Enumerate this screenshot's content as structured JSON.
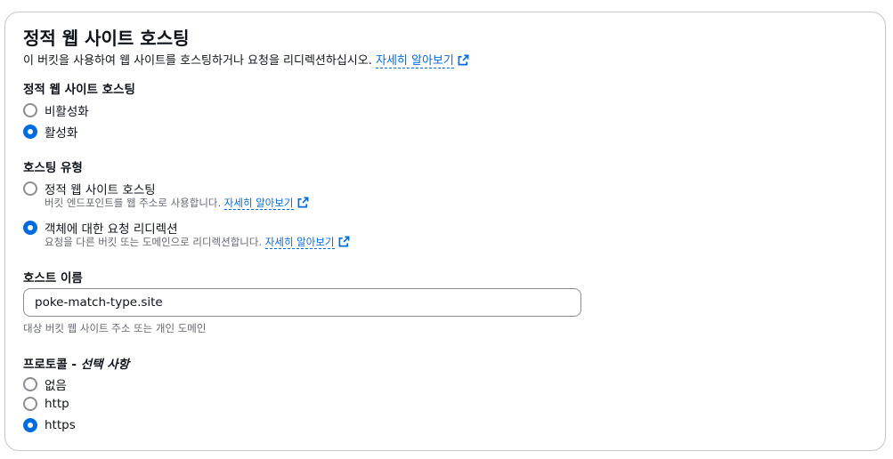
{
  "section": {
    "title": "정적 웹 사이트 호스팅",
    "description": "이 버킷을 사용하여 웹 사이트를 호스팅하거나 요청을 리디렉션하십시오.",
    "learn_more": "자세히 알아보기"
  },
  "static_hosting": {
    "label": "정적 웹 사이트 호스팅",
    "options": [
      {
        "label": "비활성화",
        "checked": false
      },
      {
        "label": "활성화",
        "checked": true
      }
    ]
  },
  "hosting_type": {
    "label": "호스팅 유형",
    "options": [
      {
        "label": "정적 웹 사이트 호스팅",
        "description": "버킷 엔드포인트를 웹 주소로 사용합니다.",
        "learn_more": "자세히 알아보기",
        "checked": false
      },
      {
        "label": "객체에 대한 요청 리디렉션",
        "description": "요청을 다른 버킷 또는 도메인으로 리디렉션합니다.",
        "learn_more": "자세히 알아보기",
        "checked": true
      }
    ]
  },
  "host_name": {
    "label": "호스트 이름",
    "value": "poke-match-type.site",
    "hint": "대상 버킷 웹 사이트 주소 또는 개인 도메인"
  },
  "protocol": {
    "label": "프로토콜 -",
    "optional": "선택 사항",
    "options": [
      {
        "label": "없음",
        "checked": false
      },
      {
        "label": "http",
        "checked": false
      },
      {
        "label": "https",
        "checked": true
      }
    ]
  },
  "colors": {
    "accent": "#006ce0",
    "text": "#0f141a",
    "muted": "#656871",
    "border": "#c6c6cd"
  }
}
